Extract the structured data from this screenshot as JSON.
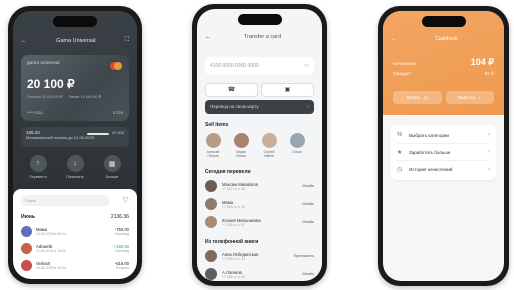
{
  "phone1": {
    "header": {
      "back_icon": "arrow-left-icon",
      "title": "Gama Universal",
      "scan_icon": "scan-icon"
    },
    "card": {
      "name": "gama universal",
      "balance": "20 100 ₽",
      "meta_left": "Остаток 10 000,00 ₽",
      "meta_right": "Лимит 10 000,00 ₽",
      "number": "**** 0211",
      "expiry": "07/28"
    },
    "limit": {
      "value": "165.33",
      "note": "Минимальный платеж до 12.06.2025",
      "right_value": "22 000"
    },
    "actions": [
      {
        "label": "Перевести",
        "icon": "arrow-up-icon"
      },
      {
        "label": "Пополнить",
        "icon": "arrow-down-icon"
      },
      {
        "label": "Больше",
        "icon": "grid-icon"
      }
    ],
    "search_placeholder": "Поиск",
    "section": {
      "title": "Июнь",
      "total": "2136.36"
    },
    "transactions": [
      {
        "name": "Мама",
        "date": "12.06.2025 в 09:14",
        "amount": "-750.00",
        "amount2": "Перевод",
        "color": "#5f6fb8"
      },
      {
        "name": "Adraenik",
        "date": "11.06.2025 в 18:02",
        "amount": "+150.00",
        "amount2": "Перевод",
        "color": "#c7614a"
      },
      {
        "name": "Velmart",
        "date": "10.06.2025 в 13:40",
        "amount": "-616.00",
        "amount2": "Покупка",
        "color": "#c94e4e"
      }
    ]
  },
  "phone2": {
    "header": {
      "back_icon": "arrow-left-icon",
      "title": "Transfer a card"
    },
    "field_value": "4100 0000 0000 0000",
    "field_icon": "card-icon",
    "twin_buttons": [
      {
        "icon": "contacts-icon"
      },
      {
        "icon": "qr-icon"
      }
    ],
    "dark_button": "Перевод на свою карту",
    "contacts_label": "Sell items",
    "contacts": [
      {
        "name": "Алексей Петров",
        "color": "#b89c86"
      },
      {
        "name": "Мария Лоева",
        "color": "#a9826d"
      },
      {
        "name": "Сергей Ивлев",
        "color": "#c8b09d"
      },
      {
        "name": "Ольга",
        "color": "#9aa7b1"
      }
    ],
    "recent_label": "Сегодня перевели",
    "recent": [
      {
        "name": "Максим Михайлов",
        "detail": "+7 912 ••• •• 45",
        "tag": "Gmails",
        "color": "#6b5b50"
      },
      {
        "name": "Мама",
        "detail": "+7 903 ••• •• 12",
        "tag": "Gmails",
        "color": "#8f7b6e"
      },
      {
        "name": "Ксения Мельникова",
        "detail": "+7 926 ••• •• 87",
        "tag": "Gmails",
        "color": "#a98d76"
      }
    ],
    "favorites_label": "Из телефонной книги",
    "favorites": [
      {
        "name": "Анна Лебединская",
        "detail": "+7 915 ••• •• 33",
        "tag": "Пригласить",
        "color": "#7e6a5e"
      },
      {
        "name": "А.Логинов",
        "detail": "+7 985 ••• •• 09",
        "tag": "Gmails",
        "color": "#5c5f63"
      }
    ]
  },
  "phone3": {
    "header": {
      "back_icon": "arrow-left-icon",
      "title": "Cashback"
    },
    "rows": [
      {
        "key": "Начислено",
        "value": "104 ₽"
      },
      {
        "key": "Ожидает",
        "value": "52 ₽"
      }
    ],
    "buttons": [
      {
        "label": "Копить",
        "icon": "coins-icon"
      },
      {
        "label": "Вывести",
        "icon": "wallet-icon"
      }
    ],
    "menu": [
      {
        "label": "Выбрать категории",
        "icon": "percent-icon"
      },
      {
        "label": "Заработать больше",
        "icon": "star-icon"
      },
      {
        "label": "История начислений",
        "icon": "clock-icon"
      }
    ],
    "accent": "#ef9d52"
  }
}
